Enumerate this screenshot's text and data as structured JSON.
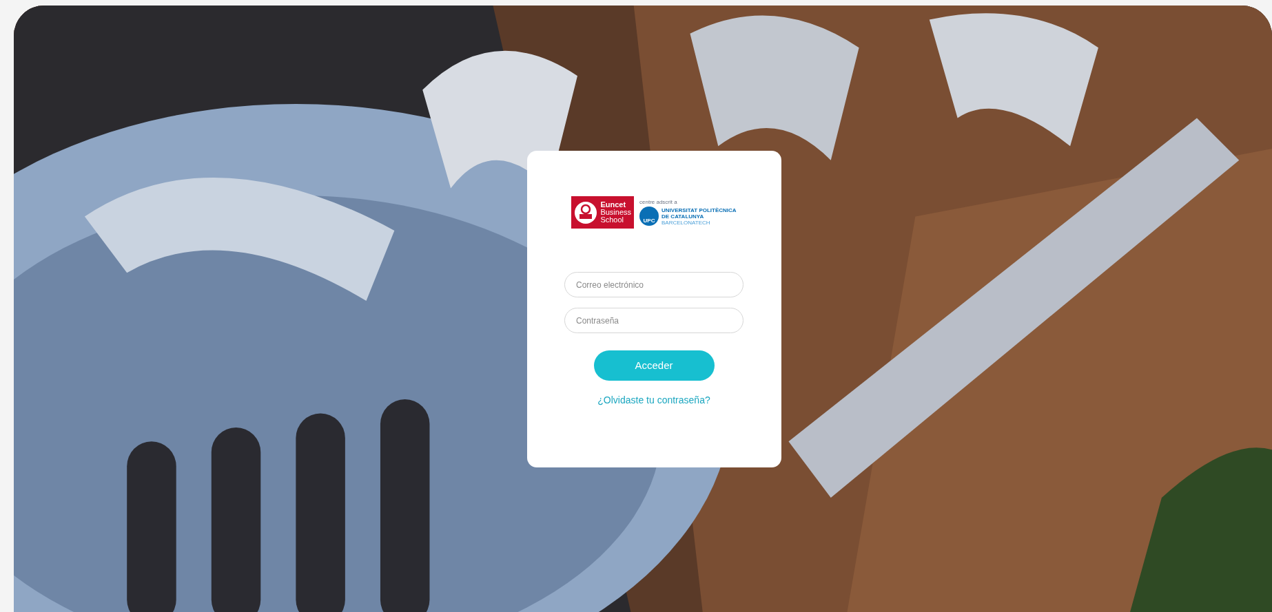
{
  "logo": {
    "school_lines": [
      "Euncet",
      "Business",
      "School"
    ],
    "affiliation": "centre adscrit a",
    "university_lines": [
      "UNIVERSITAT POLITÈCNICA",
      "DE CATALUNYA"
    ],
    "tagline": "BARCELONATECH",
    "seal": "UPC"
  },
  "form": {
    "fields": [
      {
        "placeholder": "Correo electrónico"
      },
      {
        "placeholder": "Contraseña"
      }
    ],
    "submit": "Acceder",
    "forgot_link": "¿Olvidaste tu contraseña?"
  }
}
